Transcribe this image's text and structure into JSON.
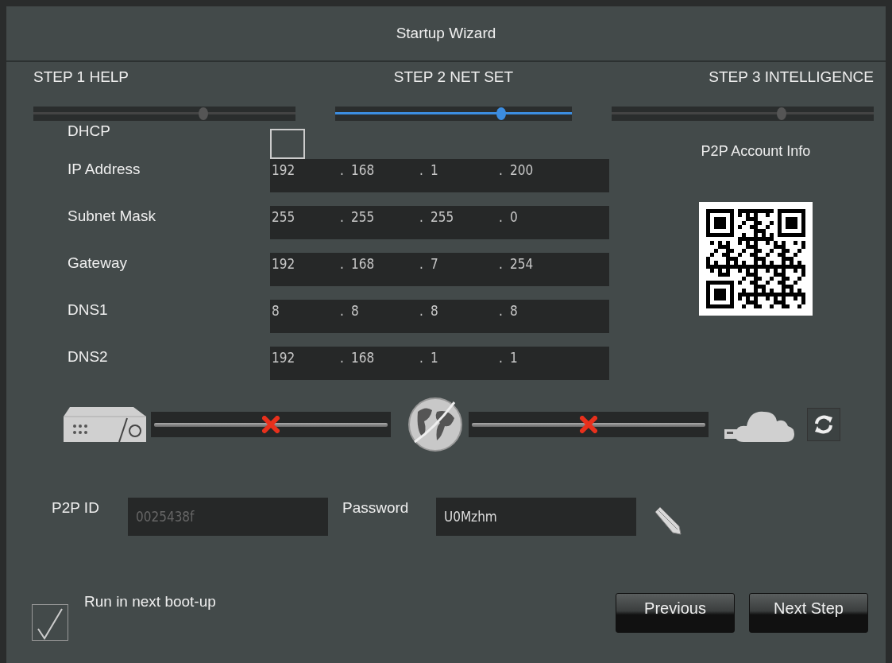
{
  "window": {
    "title": "Startup Wizard"
  },
  "steps": [
    {
      "label": "STEP 1 HELP",
      "selected": false
    },
    {
      "label": "STEP 2 NET SET",
      "selected": true
    },
    {
      "label": "STEP 3 INTELLIGENCE",
      "selected": false
    }
  ],
  "dhcp": {
    "label": "DHCP",
    "checked": false
  },
  "network_fields": [
    {
      "label": "IP Address",
      "octets": [
        "192",
        "168",
        "1",
        "200"
      ],
      "separators": [
        ".",
        ".",
        "."
      ]
    },
    {
      "label": "Subnet Mask",
      "octets": [
        "255",
        "255",
        "255",
        "0"
      ],
      "separators": [
        ".",
        ".",
        "."
      ]
    },
    {
      "label": "Gateway",
      "octets": [
        "192",
        "168",
        "7",
        "254"
      ],
      "separators": [
        ".",
        ".",
        "."
      ]
    },
    {
      "label": "DNS1",
      "octets": [
        "8",
        "8",
        "8",
        "8"
      ],
      "separators": [
        ".",
        ".",
        "."
      ]
    },
    {
      "label": "DNS2",
      "octets": [
        "192",
        "168",
        "1",
        "1"
      ],
      "separators": [
        ".",
        ".",
        "."
      ]
    }
  ],
  "p2p_panel": {
    "title": "P2P Account Info"
  },
  "connection": [
    {
      "connected": false
    },
    {
      "connected": false
    }
  ],
  "p2p_id": {
    "label": "P2P ID",
    "value": "0025438f",
    "disabled": true
  },
  "password": {
    "label": "Password",
    "value": "U0Mzhm"
  },
  "run_next_boot": {
    "label": "Run in next boot-up",
    "checked": true
  },
  "buttons": [
    "Previous",
    "Next Step"
  ]
}
